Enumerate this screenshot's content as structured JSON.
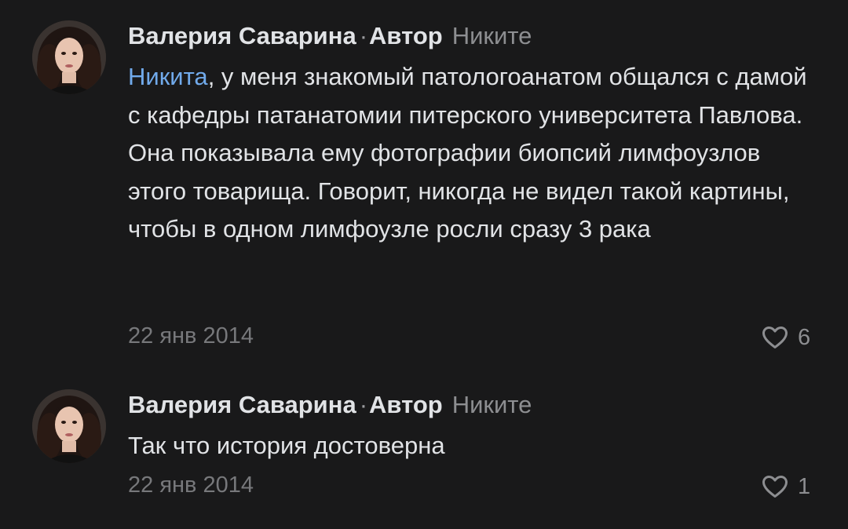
{
  "comments": [
    {
      "author": "Валерия Саварина",
      "separator": "·",
      "role": "Автор",
      "reply_to": "Никите",
      "mention": "Никита",
      "text": ", у меня знакомый патологоанатом общался с дамой с кафедры патанатомии питерского университета Павлова. Она показывала ему фотографии биопсий лимфоузлов этого товарища. Говорит, никогда не видел такой картины, чтобы в одном лимфоузле росли сразу 3 рака",
      "date": "22 янв 2014",
      "likes": "6",
      "like_icon": "heart-outline-icon"
    },
    {
      "author": "Валерия Саварина",
      "separator": "·",
      "role": "Автор",
      "reply_to": "Никите",
      "text": "Так что история достоверна",
      "date": "22 янв 2014",
      "likes": "1",
      "like_icon": "heart-outline-icon"
    }
  ],
  "colors": {
    "background": "#19191a",
    "text": "#e1e3e6",
    "secondary": "#8d8e91",
    "date": "#77787b",
    "link": "#71aaeb"
  }
}
